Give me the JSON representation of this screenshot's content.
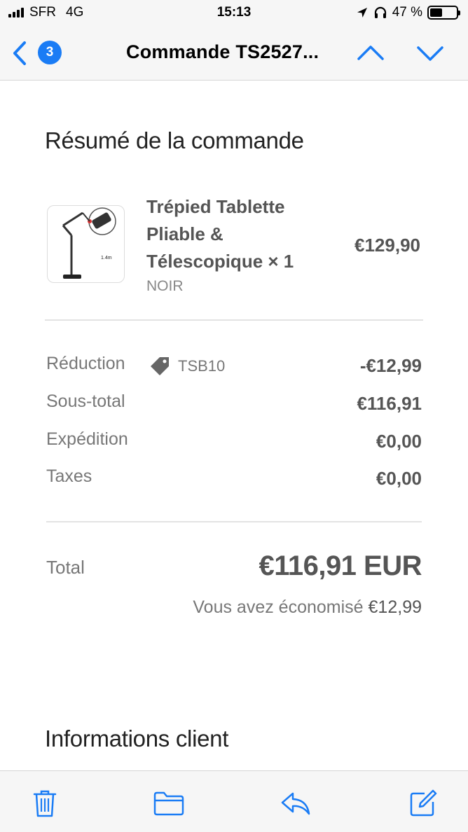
{
  "status_bar": {
    "carrier": "SFR",
    "network": "4G",
    "time": "15:13",
    "battery_percent": "47 %",
    "battery_level": 0.47
  },
  "nav": {
    "badge_count": "3",
    "title": "Commande TS2527..."
  },
  "summary": {
    "title": "Résumé de la commande",
    "product": {
      "name": "Trépied Tablette Pliable & Télescopique × 1",
      "variant": "NOIR",
      "price": "€129,90",
      "image_caption": "1.4m"
    },
    "discount": {
      "label": "Réduction",
      "code": "TSB10",
      "value": "-€12,99"
    },
    "subtotal": {
      "label": "Sous-total",
      "value": "€116,91"
    },
    "shipping": {
      "label": "Expédition",
      "value": "€0,00"
    },
    "taxes": {
      "label": "Taxes",
      "value": "€0,00"
    },
    "total": {
      "label": "Total",
      "value": "€116,91 EUR"
    },
    "savings": {
      "label": "Vous avez économisé",
      "value": "€12,99"
    }
  },
  "customer": {
    "title": "Informations client"
  },
  "colors": {
    "accent": "#1a7cf5",
    "text_strong": "#555555",
    "text_muted": "#777777"
  },
  "toolbar_icons": [
    "trash-icon",
    "folder-icon",
    "reply-icon",
    "compose-icon"
  ]
}
